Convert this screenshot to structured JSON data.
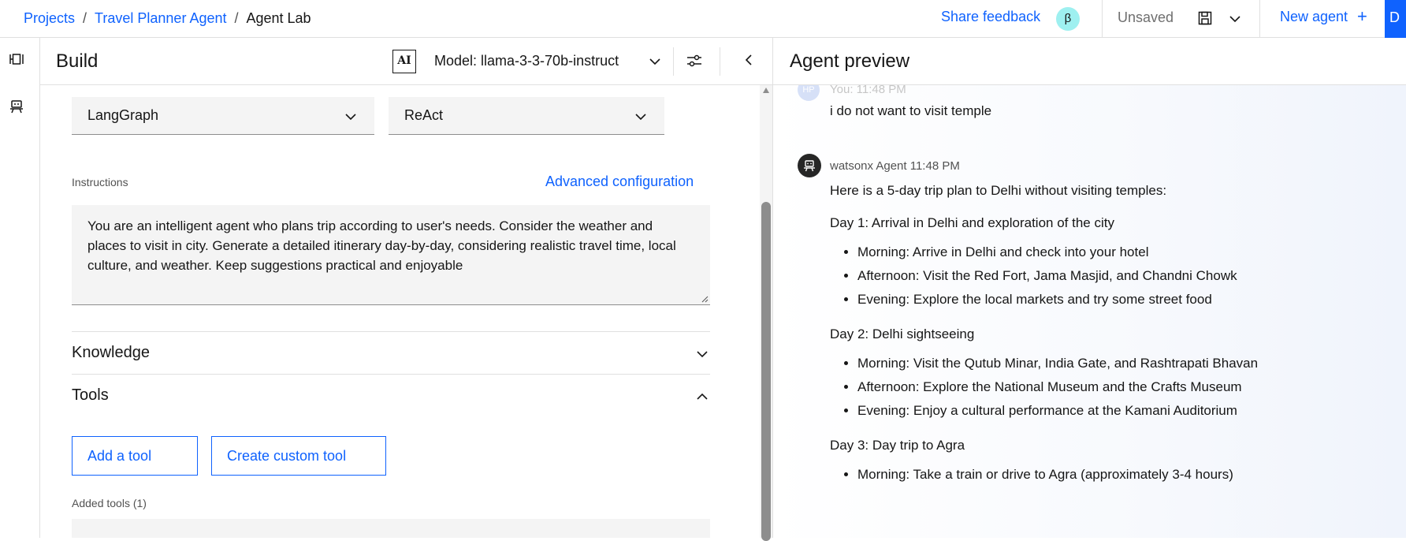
{
  "breadcrumb": {
    "items": [
      "Projects",
      "Travel Planner Agent",
      "Agent Lab"
    ],
    "separator": "/"
  },
  "topbar": {
    "share_feedback": "Share feedback",
    "beta_badge": "β",
    "save_status": "Unsaved",
    "new_agent": "New agent",
    "new_agent_plus": "+",
    "deploy_label": "D"
  },
  "build": {
    "title": "Build",
    "ai_badge": "AI",
    "model_label": "Model: llama-3-3-70b-instruct",
    "framework_select": "LangGraph",
    "architecture_select": "ReAct",
    "instructions_label": "Instructions",
    "advanced_config": "Advanced configuration",
    "instructions_text": "You are an intelligent agent who plans trip according to user's needs. Consider the weather and places to visit in city. Generate a detailed itinerary day-by-day, considering realistic travel time, local culture, and weather. Keep suggestions practical and enjoyable",
    "knowledge_title": "Knowledge",
    "tools_title": "Tools",
    "add_tool": "Add a tool",
    "create_custom_tool": "Create custom tool",
    "added_tools_label": "Added tools (1)"
  },
  "preview": {
    "title": "Agent preview",
    "user_avatar": "HP",
    "user_meta": "You: 11:48 PM",
    "user_message": "i do not want to visit temple",
    "agent_meta": "watsonx Agent 11:48 PM",
    "agent_intro": "Here is a 5-day trip plan to Delhi without visiting temples:",
    "days": [
      {
        "title": "Day 1: Arrival in Delhi and exploration of the city",
        "items": [
          "Morning: Arrive in Delhi and check into your hotel",
          "Afternoon: Visit the Red Fort, Jama Masjid, and Chandni Chowk",
          "Evening: Explore the local markets and try some street food"
        ]
      },
      {
        "title": "Day 2: Delhi sightseeing",
        "items": [
          "Morning: Visit the Qutub Minar, India Gate, and Rashtrapati Bhavan",
          "Afternoon: Explore the National Museum and the Crafts Museum",
          "Evening: Enjoy a cultural performance at the Kamani Auditorium"
        ]
      },
      {
        "title": "Day 3: Day trip to Agra",
        "items": [
          "Morning: Take a train or drive to Agra (approximately 3-4 hours)"
        ]
      }
    ]
  },
  "icons": {
    "rail": [
      "flow-icon",
      "agent-icon"
    ],
    "header": [
      "settings-adjust-icon",
      "collapse-left-icon",
      "chevron-down-icon",
      "save-icon"
    ]
  },
  "colors": {
    "accent": "#0f62fe",
    "beta_bg": "#9ef0f0",
    "field_bg": "#f4f4f4",
    "border": "#e0e0e0"
  }
}
